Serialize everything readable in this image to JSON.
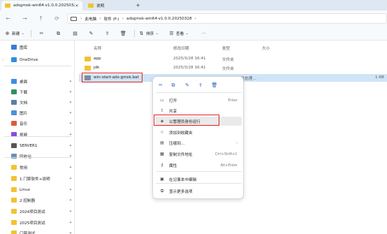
{
  "tabs": [
    {
      "label": "adsgmsk-win64-v1.0.0.2025032…",
      "active": true
    },
    {
      "label": "说明",
      "active": false
    }
  ],
  "breadcrumb": [
    "此电脑",
    "软件 (F:)",
    "adsgmsk-win64-v1.0.0.20250328"
  ],
  "toolbar": {
    "new_label": "新建",
    "sort_label": "排序",
    "view_label": "查看",
    "more_label": "···"
  },
  "sidebar": {
    "items": [
      {
        "label": "图库",
        "icon": "gallery-icon",
        "color": "#3a7bd5",
        "chevron": ""
      },
      {
        "label": "OneDrive",
        "icon": "cloud-icon",
        "color": "#2f8fe0",
        "chevron": "›"
      },
      {
        "label": "桌面",
        "icon": "desktop-icon",
        "color": "#3a8ee6",
        "pin": true
      },
      {
        "label": "下载",
        "icon": "download-icon",
        "color": "#2f8f5f",
        "pin": true
      },
      {
        "label": "文档",
        "icon": "document-icon",
        "color": "#5b7fa6",
        "pin": true
      },
      {
        "label": "图片",
        "icon": "picture-icon",
        "color": "#4a90d9",
        "pin": true
      },
      {
        "label": "音乐",
        "icon": "music-icon",
        "color": "#e05a3a",
        "pin": true
      },
      {
        "label": "视频",
        "icon": "video-icon",
        "color": "#8a4fd8",
        "pin": true
      },
      {
        "label": "SERVER1",
        "icon": "network-drive-icon",
        "color": "#555555",
        "pin": true
      },
      {
        "label": "回收站",
        "icon": "recycle-bin-icon",
        "color": "#6b8fb8",
        "pin": true
      },
      {
        "label": "常用",
        "icon": "folder-icon",
        "color": "#f3c232",
        "pin": true
      },
      {
        "label": "1.门禁软件+说明",
        "icon": "folder-icon",
        "color": "#f3c232",
        "pin": true
      },
      {
        "label": "Linux",
        "icon": "folder-icon",
        "color": "#f3c232",
        "pin": true
      },
      {
        "label": "2.控制器",
        "icon": "folder-icon",
        "color": "#f3c232",
        "pin": true
      },
      {
        "label": "2024项目测试",
        "icon": "folder-icon",
        "color": "#f3c232",
        "pin": true
      },
      {
        "label": "2025项目测试",
        "icon": "folder-icon",
        "color": "#f3c232",
        "pin": true
      },
      {
        "label": "门禁测试",
        "icon": "folder-icon",
        "color": "#f3c232",
        "pin": true
      }
    ]
  },
  "columns": {
    "name": "名称",
    "date": "修改日期",
    "type": "类型",
    "size": "大小"
  },
  "files": [
    {
      "name": "app",
      "date": "2025/3/28 16:41",
      "type": "文件夹",
      "size": "",
      "icon": "folder-icon",
      "color": "#f3c232"
    },
    {
      "name": "jdk",
      "date": "2025/3/28 16:41",
      "type": "文件夹",
      "size": "",
      "icon": "folder-icon",
      "color": "#f3c232"
    },
    {
      "name": "win-start-ads-gmsk.bat",
      "date": "",
      "type": "Windows 批处理...",
      "size": "1 KB",
      "icon": "batch-file-icon",
      "color": "#7a8ca3"
    }
  ],
  "context_menu": {
    "quick_actions": [
      "cut-icon",
      "copy-icon",
      "rename-icon",
      "share-icon",
      "delete-icon"
    ],
    "items": [
      {
        "label": "打开",
        "shortcut": "Enter",
        "icon": "open-icon",
        "glyph": "▭"
      },
      {
        "label": "共享",
        "shortcut": "",
        "icon": "share-icon",
        "glyph": "⇪"
      },
      {
        "label": "以管理员身份运行",
        "shortcut": "",
        "icon": "shield-icon",
        "glyph": "◈"
      },
      {
        "label": "添加到收藏夹",
        "shortcut": "",
        "icon": "star-icon",
        "glyph": "☆"
      },
      {
        "label": "压缩到...",
        "shortcut": "",
        "icon": "zip-icon",
        "glyph": "▤",
        "submenu": "›"
      },
      {
        "label": "复制文件地址",
        "shortcut": "Ctrl+Shift+C",
        "icon": "copy-path-icon",
        "glyph": "▦"
      },
      {
        "label": "属性",
        "shortcut": "Alt+Enter",
        "icon": "properties-icon",
        "glyph": "⚷"
      },
      {
        "label": "在记事本中编辑",
        "shortcut": "",
        "icon": "notepad-icon",
        "glyph": "▣"
      },
      {
        "label": "显示更多选项",
        "shortcut": "",
        "icon": "more-options-icon",
        "glyph": "⧉"
      }
    ]
  }
}
